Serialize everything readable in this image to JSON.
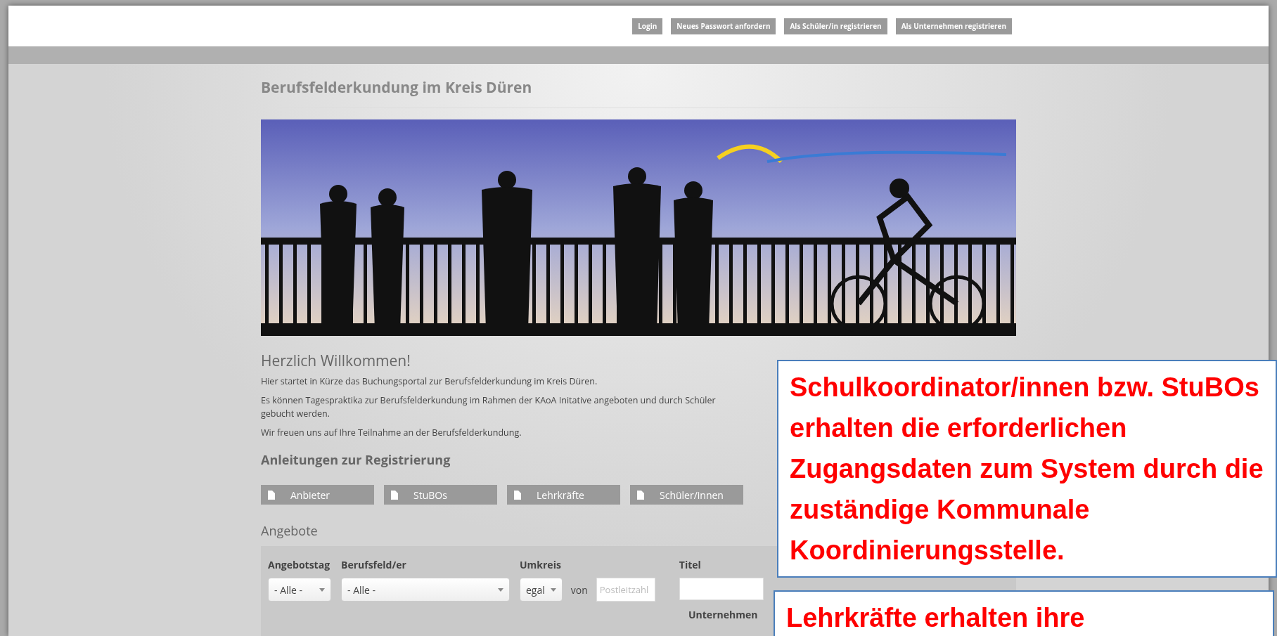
{
  "nav": [
    "Login",
    "Neues Passwort anfordern",
    "Als Schüler/in registrieren",
    "Als Unternehmen registrieren"
  ],
  "page_title": "Berufsfelderkundung im Kreis Düren",
  "welcome": {
    "heading": "Herzlich Willkommen!",
    "paragraphs": [
      "Hier startet in Kürze das Buchungsportal zur Berufsfelderkundung im Kreis Düren.",
      "Es können Tagespraktika zur Berufsfelderkundung im Rahmen der KAoA Initative angeboten und durch Schüler gebucht werden.",
      "Wir freuen uns auf Ihre Teilnahme an der Berufsfelderkundung."
    ]
  },
  "guides": {
    "heading": "Anleitungen zur Registrierung",
    "buttons": [
      "Anbieter",
      "StuBOs",
      "Lehrkräfte",
      "Schüler/innen"
    ]
  },
  "offers": {
    "heading": "Angebote",
    "filters": [
      {
        "kind": "select",
        "label": "Angebotstag",
        "value": "- Alle -"
      },
      {
        "kind": "select",
        "label": "Berufsfeld/er",
        "value": "- Alle -"
      },
      {
        "kind": "radius",
        "label": "Umkreis",
        "value": "egal",
        "connector": "von",
        "placeholder": "Postleitzahl"
      },
      {
        "kind": "text",
        "label": "Titel"
      }
    ],
    "extra_label": "Unternehmen"
  },
  "callouts": [
    {
      "text": "Schulkoordinator/innen bzw. StuBOs erhalten die erforderlichen Zugangsdaten zum System durch die zuständige Kommunale Koordinierungsstelle."
    },
    {
      "text": "Lehrkräfte erhalten ihre"
    }
  ]
}
